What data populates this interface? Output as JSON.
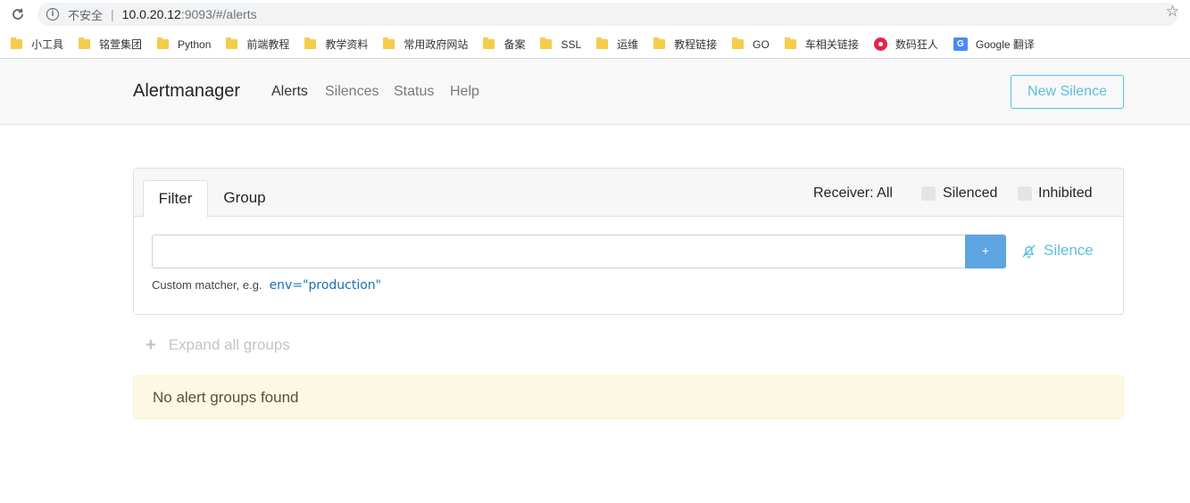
{
  "browser": {
    "security_label": "不安全",
    "url_host": "10.0.20.12",
    "url_rest": ":9093/#/alerts",
    "bookmarks": [
      {
        "label": "小工具",
        "icon": "folder-icon"
      },
      {
        "label": "铭萱集团",
        "icon": "folder-icon"
      },
      {
        "label": "Python",
        "icon": "folder-icon"
      },
      {
        "label": "前端教程",
        "icon": "folder-icon"
      },
      {
        "label": "教学资料",
        "icon": "folder-icon"
      },
      {
        "label": "常用政府网站",
        "icon": "folder-icon"
      },
      {
        "label": "备案",
        "icon": "folder-icon"
      },
      {
        "label": "SSL",
        "icon": "folder-icon"
      },
      {
        "label": "运维",
        "icon": "folder-icon"
      },
      {
        "label": "教程链接",
        "icon": "folder-icon"
      },
      {
        "label": "GO",
        "icon": "folder-icon"
      },
      {
        "label": "车相关链接",
        "icon": "folder-icon"
      },
      {
        "label": "数码狂人",
        "icon": "site-icon"
      },
      {
        "label": "Google 翻译",
        "icon": "google-translate-icon"
      }
    ]
  },
  "navbar": {
    "brand": "Alertmanager",
    "links": [
      "Alerts",
      "Silences",
      "Status",
      "Help"
    ],
    "new_silence": "New Silence"
  },
  "filter_card": {
    "tabs": [
      "Filter",
      "Group"
    ],
    "receiver": "Receiver: All",
    "silenced_label": "Silenced",
    "inhibited_label": "Inhibited",
    "input_value": "",
    "add_label": "+",
    "silence_label": "Silence",
    "hint_text": "Custom matcher, e.g.",
    "hint_example": "env=\"production\""
  },
  "expand_label": "Expand all groups",
  "empty_message": "No alert groups found",
  "colors": {
    "accent": "#5bc0de",
    "primary": "#5da4e0",
    "warning_bg": "#fcf8e3"
  }
}
